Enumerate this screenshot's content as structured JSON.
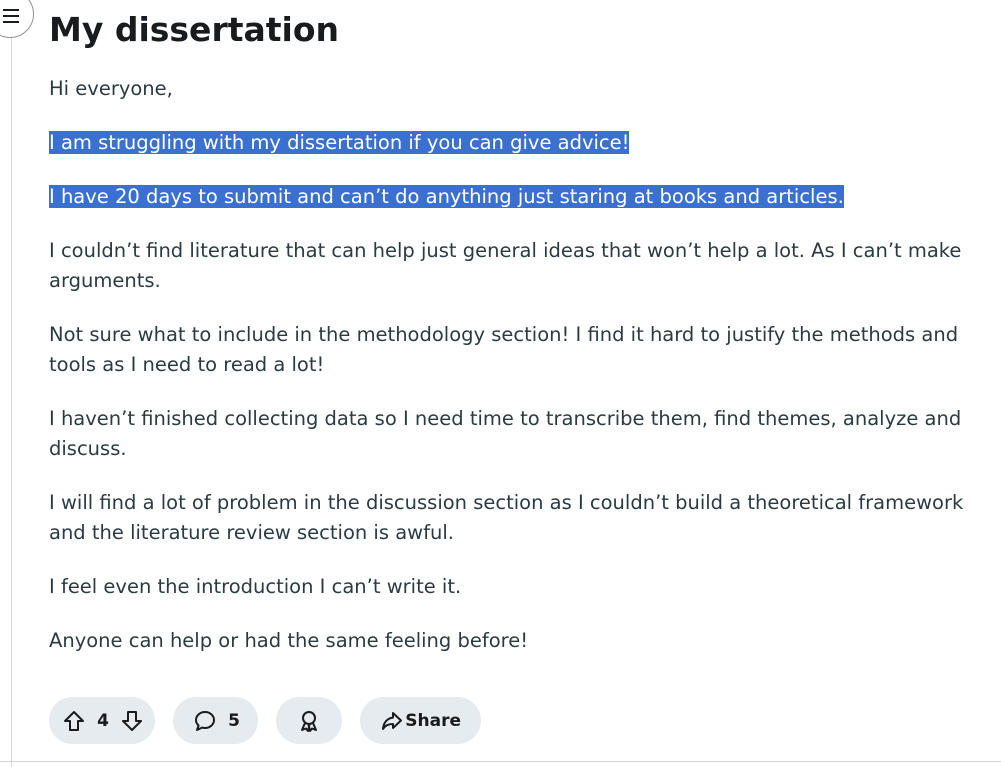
{
  "post": {
    "title": "My dissertation",
    "paragraphs": [
      {
        "text": "Hi everyone,",
        "selected": false
      },
      {
        "text": "I am struggling with my dissertation if you can give advice!",
        "selected": true
      },
      {
        "text": "I have 20 days to submit and can’t do anything just staring at books and articles.",
        "selected": true
      },
      {
        "text": "I couldn’t find literature that can help just general ideas that won’t help a lot. As I can’t make arguments.",
        "selected": false
      },
      {
        "text": "Not sure what to include in the methodology section! I find it hard to justify the methods and tools as I need to read a lot!",
        "selected": false
      },
      {
        "text": "I haven’t finished collecting data so I need time to transcribe them, find themes, analyze and discuss.",
        "selected": false
      },
      {
        "text": "I will find a lot of problem in the discussion section as I couldn’t build a theoretical framework and the literature review section is awful.",
        "selected": false
      },
      {
        "text": "I feel even the introduction I can’t write it.",
        "selected": false
      },
      {
        "text": "Anyone can help or had the same feeling before!",
        "selected": false
      }
    ]
  },
  "actions": {
    "vote_count": "4",
    "comment_count": "5",
    "share_label": "Share"
  },
  "icons": {
    "menu": "hamburger-menu-icon",
    "upvote": "upvote-arrow-icon",
    "downvote": "downvote-arrow-icon",
    "comment": "comment-bubble-icon",
    "award": "award-ribbon-icon",
    "share": "share-arrow-icon"
  },
  "colors": {
    "selection_highlight": "#3a70d0",
    "pill_background": "#e5ebee",
    "body_text": "#2a3c42",
    "title_text": "#181c1f"
  }
}
